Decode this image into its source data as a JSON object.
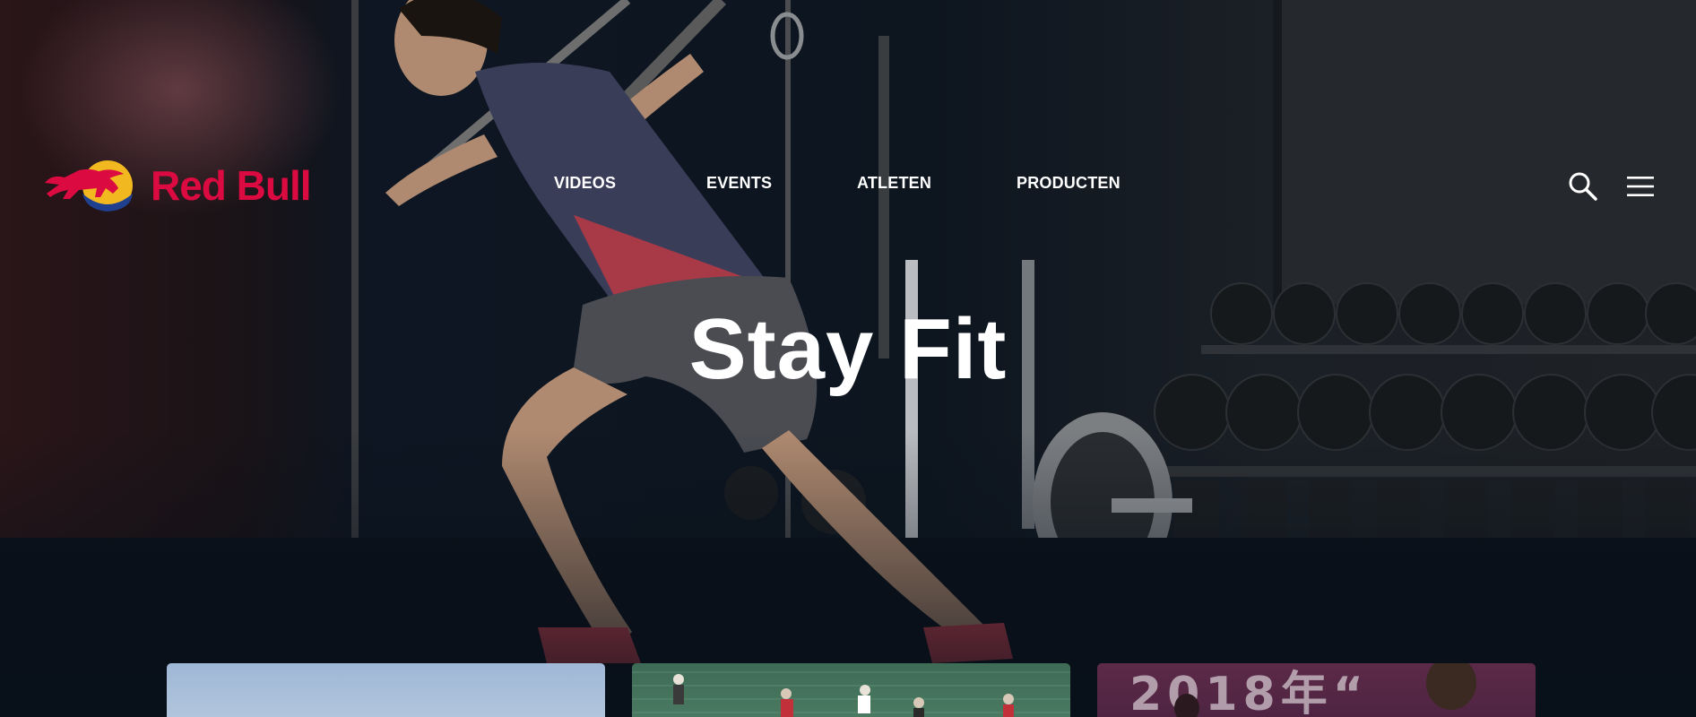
{
  "brand": {
    "name": "Red Bull",
    "color": "#db0a40"
  },
  "nav": {
    "items": [
      {
        "label": "VIDEOS"
      },
      {
        "label": "EVENTS"
      },
      {
        "label": "ATLETEN"
      },
      {
        "label": "PRODUCTEN"
      }
    ]
  },
  "header_icons": {
    "search": "search-icon",
    "menu": "hamburger-menu-icon"
  },
  "hero": {
    "title": "Stay Fit",
    "image": "woman doing suspension training in gym"
  },
  "cards": [
    {
      "image": "outdoor sky scene"
    },
    {
      "image": "people climbing green net"
    },
    {
      "image": "event stage with banner"
    }
  ],
  "card_banner_text": "2018年“"
}
